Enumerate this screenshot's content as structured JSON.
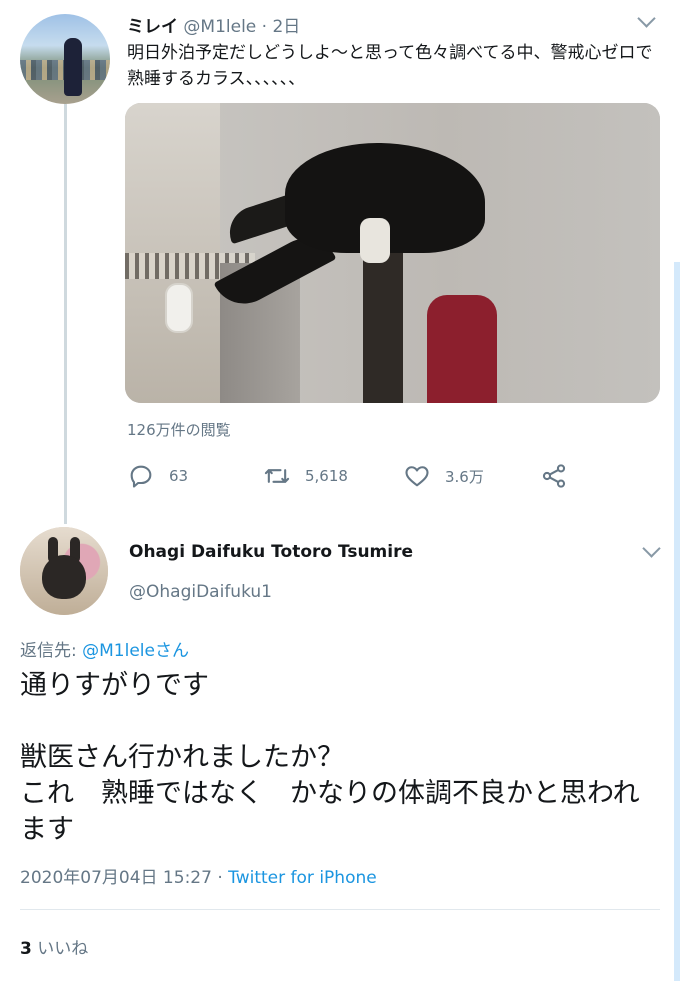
{
  "tweet1": {
    "display_name": "ミレイ",
    "handle": "@M1lele",
    "time": "2日",
    "separator": " · ",
    "text": "明日外泊予定だしどうしよ〜と思って色々調べてる中、警戒心ゼロで熟睡するカラス、、、、、、",
    "views": "126万件の閲覧",
    "reply_count": "63",
    "retweet_count": "5,618",
    "like_count": "3.6万"
  },
  "tweet2": {
    "display_name": "Ohagi Daifuku Totoro Tsumire",
    "handle": "@OhagiDaifuku1",
    "replying_to_label": "返信先: ",
    "replying_to_user": "@M1leleさん",
    "lines": [
      "通りすがりです",
      "",
      "獣医さん行かれましたか？",
      "これ　熟睡ではなく　かなりの体調不良かと思われます"
    ],
    "timestamp": "2020年07月04日 15:27",
    "timestamp_sep": " · ",
    "source": "Twitter for iPhone",
    "likes_count": "3",
    "likes_label": " いいね"
  },
  "icons": {
    "reply": "reply-icon",
    "retweet": "retweet-icon",
    "like": "heart-icon",
    "share": "share-icon",
    "menu": "chevron-down-icon"
  },
  "colors": {
    "link": "#1b95e0",
    "secondary": "#657786",
    "text": "#14171a",
    "divider": "#e1e8ed"
  }
}
